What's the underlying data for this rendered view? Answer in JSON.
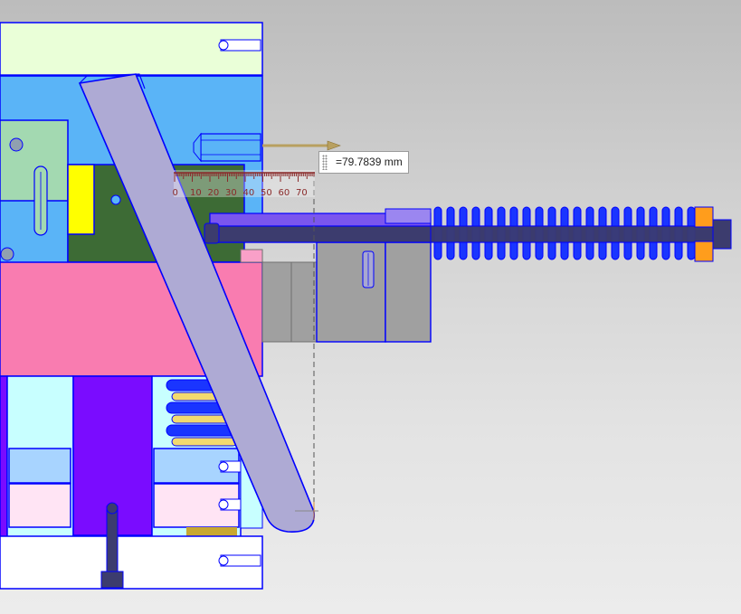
{
  "viewport": {
    "background_top": "#bcbcbc",
    "background_bottom": "#ececec"
  },
  "measurement": {
    "value_text": "=79.7839 mm",
    "ruler_labels": [
      "0",
      "10",
      "20",
      "30",
      "40",
      "50",
      "60",
      "70"
    ],
    "ruler_color": "#8a2a2a",
    "arrow_color": "#b8a060",
    "icon": "drag-grip-icon"
  },
  "colors": {
    "edge_blue": "#0000ff",
    "top_plate": "#eaffd8",
    "plate_blue": "#5ab4f7",
    "pink_plate": "#f97cb0",
    "purple_block": "#7a0cff",
    "light_cyan": "#c8ffff",
    "light_blue_block": "#a8d4ff",
    "light_pink_block": "#ffe4f4",
    "green_block": "#3d6b35",
    "pale_green_block": "#a3d9b1",
    "yellow_insert": "#ffff00",
    "angle_pin": "#aeaad4",
    "slider_gray": "#a0a0a0",
    "spring_blue": "#1a35ff",
    "spring_yellow": "#f2da6e",
    "rod_dark": "#3c3c6e",
    "orange_nut": "#ff9d1c",
    "core_purple": "#7b56ee"
  }
}
